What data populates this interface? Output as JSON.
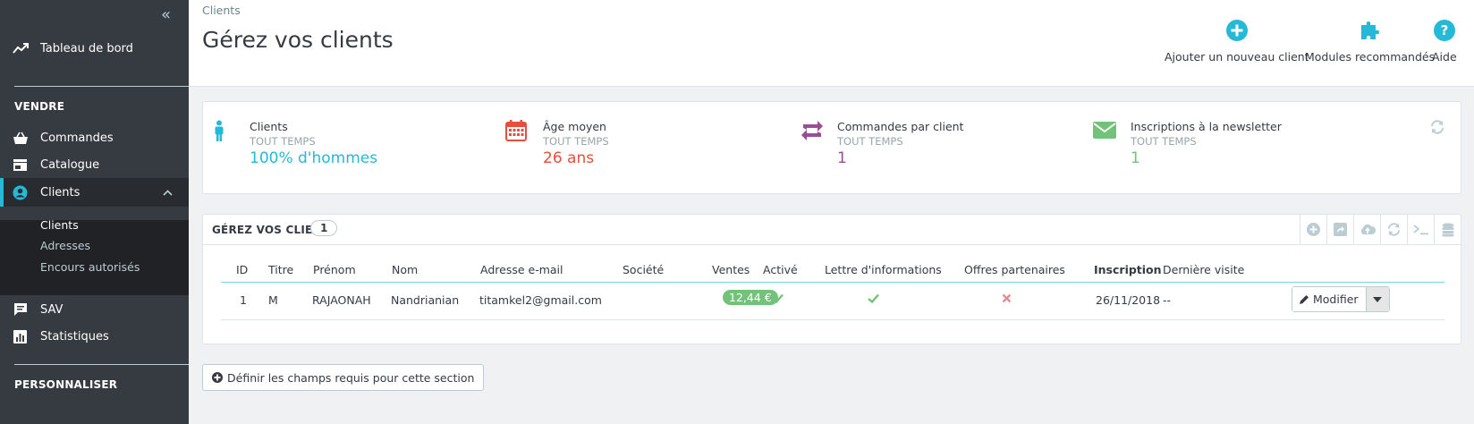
{
  "sidebar": {
    "dashboard": "Tableau de bord",
    "section_sell": "VENDRE",
    "items": [
      {
        "label": "Commandes"
      },
      {
        "label": "Catalogue"
      },
      {
        "label": "Clients"
      },
      {
        "label": "SAV"
      },
      {
        "label": "Statistiques"
      }
    ],
    "submenu": [
      "Clients",
      "Adresses",
      "Encours autorisés"
    ],
    "section_customize": "PERSONNALISER"
  },
  "header": {
    "breadcrumb": "Clients",
    "title": "Gérez vos clients",
    "toolbar": {
      "add_client": "Ajouter un nouveau client",
      "modules": "Modules recommandés",
      "help": "Aide"
    }
  },
  "kpis": [
    {
      "title": "Clients",
      "subtitle": "TOUT TEMPS",
      "value": "100% d'hommes",
      "color": "#25b9d7"
    },
    {
      "title": "Âge moyen",
      "subtitle": "TOUT TEMPS",
      "value": "26 ans",
      "color": "#e84e3c"
    },
    {
      "title": "Commandes par client",
      "subtitle": "TOUT TEMPS",
      "value": "1",
      "color": "#9c4c95"
    },
    {
      "title": "Inscriptions à la newsletter",
      "subtitle": "TOUT TEMPS",
      "value": "1",
      "color": "#72c279"
    }
  ],
  "panel": {
    "title": "GÉREZ VOS CLIENTS",
    "count": "1"
  },
  "table": {
    "headers": [
      "ID",
      "Titre",
      "Prénom",
      "Nom",
      "Adresse e-mail",
      "Société",
      "Ventes",
      "Activé",
      "Lettre d'informations",
      "Offres partenaires",
      "Inscription",
      "Dernière visite"
    ],
    "rows": [
      {
        "id": "1",
        "title": "M",
        "first_name": "RAJAONAH",
        "last_name": "Nandrianian",
        "email": "titamkel2@gmail.com",
        "company": "",
        "sales": "12,44 €",
        "active": true,
        "newsletter": true,
        "optin": false,
        "registered": "26/11/2018",
        "last_visit": "--",
        "action": "Modifier"
      }
    ]
  },
  "required_fields_button": "Définir les champs requis pour cette section"
}
